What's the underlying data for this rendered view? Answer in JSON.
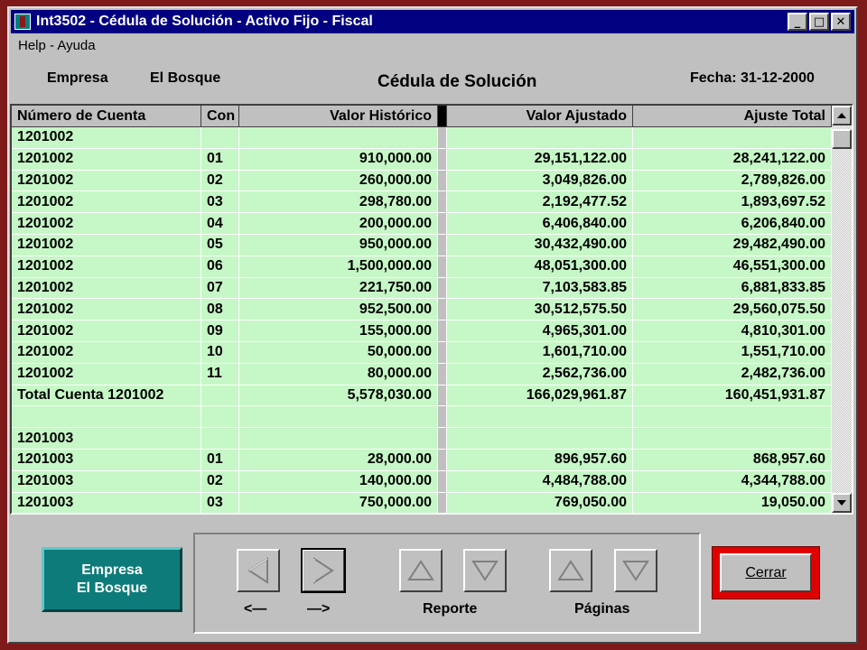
{
  "window": {
    "title": "Int3502 - Cédula de Solución - Activo Fijo - Fiscal",
    "minimize": "_",
    "maximize": "□",
    "close": "✕"
  },
  "menu": {
    "help": "Help - Ayuda"
  },
  "header": {
    "empresa_label": "Empresa",
    "empresa_value": "El Bosque",
    "title": "Cédula de Solución",
    "fecha": "Fecha: 31-12-2000"
  },
  "grid": {
    "columns": [
      "Número de Cuenta",
      "Con",
      "Valor Histórico",
      "Valor Ajustado",
      "Ajuste Total"
    ],
    "rows": [
      [
        "1201002",
        "",
        "",
        "",
        ""
      ],
      [
        "1201002",
        "01",
        "910,000.00",
        "29,151,122.00",
        "28,241,122.00"
      ],
      [
        "1201002",
        "02",
        "260,000.00",
        "3,049,826.00",
        "2,789,826.00"
      ],
      [
        "1201002",
        "03",
        "298,780.00",
        "2,192,477.52",
        "1,893,697.52"
      ],
      [
        "1201002",
        "04",
        "200,000.00",
        "6,406,840.00",
        "6,206,840.00"
      ],
      [
        "1201002",
        "05",
        "950,000.00",
        "30,432,490.00",
        "29,482,490.00"
      ],
      [
        "1201002",
        "06",
        "1,500,000.00",
        "48,051,300.00",
        "46,551,300.00"
      ],
      [
        "1201002",
        "07",
        "221,750.00",
        "7,103,583.85",
        "6,881,833.85"
      ],
      [
        "1201002",
        "08",
        "952,500.00",
        "30,512,575.50",
        "29,560,075.50"
      ],
      [
        "1201002",
        "09",
        "155,000.00",
        "4,965,301.00",
        "4,810,301.00"
      ],
      [
        "1201002",
        "10",
        "50,000.00",
        "1,601,710.00",
        "1,551,710.00"
      ],
      [
        "1201002",
        "11",
        "80,000.00",
        "2,562,736.00",
        "2,482,736.00"
      ],
      [
        "Total Cuenta 1201002",
        "",
        "5,578,030.00",
        "166,029,961.87",
        "160,451,931.87"
      ],
      [
        "",
        "",
        "",
        "",
        ""
      ],
      [
        "1201003",
        "",
        "",
        "",
        ""
      ],
      [
        "1201003",
        "01",
        "28,000.00",
        "896,957.60",
        "868,957.60"
      ],
      [
        "1201003",
        "02",
        "140,000.00",
        "4,484,788.00",
        "4,344,788.00"
      ],
      [
        "1201003",
        "03",
        "750,000.00",
        "769,050.00",
        "19,050.00"
      ]
    ]
  },
  "buttons": {
    "empresa_line1": "Empresa",
    "empresa_line2": "El Bosque",
    "prev_arrow_label": "<—",
    "next_arrow_label": "—>",
    "reporte_label": "Reporte",
    "paginas_label": "Páginas",
    "cerrar_label": "Cerrar"
  },
  "colors": {
    "row_bg": "#c6f7c6",
    "titlebar": "#000080",
    "empresa_btn": "#0e7b7b",
    "cerrar_frame": "#e00000"
  }
}
